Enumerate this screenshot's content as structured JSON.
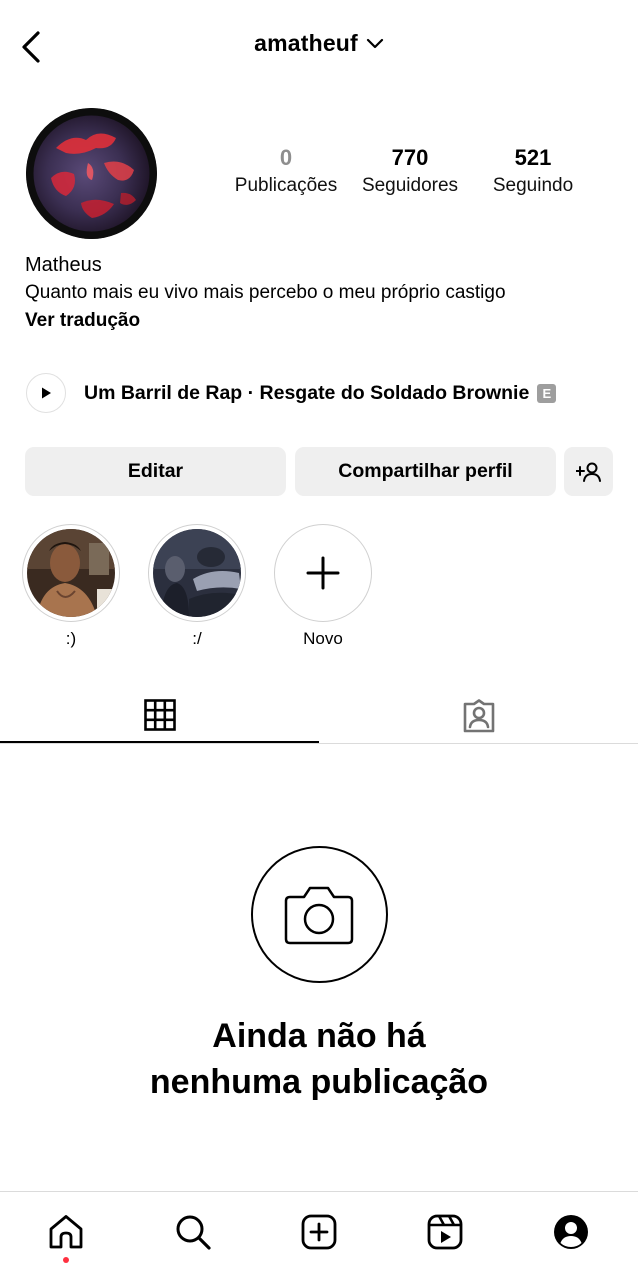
{
  "header": {
    "username": "amatheuf"
  },
  "profile": {
    "stats": [
      {
        "value": "0",
        "label": "Publicações"
      },
      {
        "value": "770",
        "label": "Seguidores"
      },
      {
        "value": "521",
        "label": "Seguindo"
      }
    ],
    "name": "Matheus",
    "bio": "Quanto mais eu vivo mais percebo o meu próprio castigo",
    "translate_link": "Ver tradução",
    "music": {
      "title": "Um Barril de Rap · Resgate do Soldado Brownie",
      "explicit_badge": "E"
    }
  },
  "actions": {
    "edit_label": "Editar",
    "share_label": "Compartilhar perfil"
  },
  "highlights": [
    {
      "label": ":)"
    },
    {
      "label": ":/"
    },
    {
      "label": "Novo"
    }
  ],
  "tabs": [
    {
      "icon": "grid-icon",
      "selected": true
    },
    {
      "icon": "tagged-icon",
      "selected": false
    }
  ],
  "empty_state": {
    "line1": "Ainda não há",
    "line2": "nenhuma publicação"
  },
  "bottom_nav": [
    "home-icon",
    "search-icon",
    "create-icon",
    "reels-icon",
    "profile-icon"
  ],
  "colors": {
    "notification_dot": "#ff3040",
    "button_bg": "#efefef"
  }
}
